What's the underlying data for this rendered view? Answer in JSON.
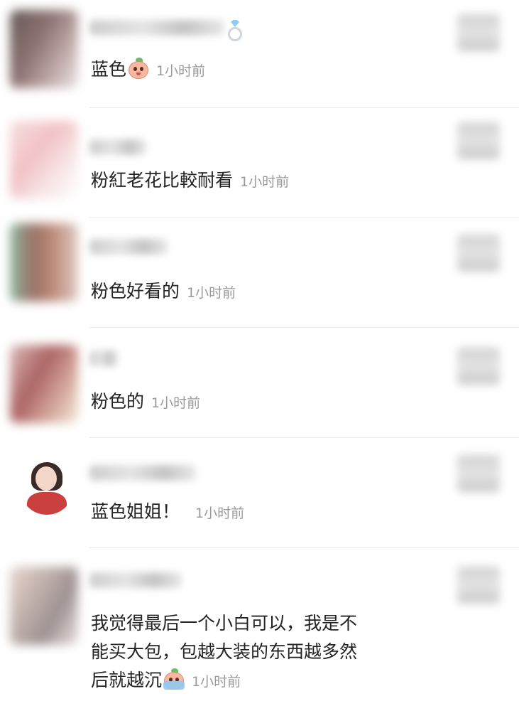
{
  "comments": [
    {
      "text": "蓝色",
      "time": "1小时前",
      "emoji": "peach-shy-emoji"
    },
    {
      "text": "粉紅老花比較耐看",
      "time": "1小时前"
    },
    {
      "text": "粉色好看的",
      "time": "1小时前"
    },
    {
      "text": "粉色的",
      "time": "1小时前"
    },
    {
      "text": "蓝色姐姐！",
      "time": "1小时前"
    },
    {
      "text_lines": [
        "我觉得最后一个小白可以，我是不",
        "能买大包，包越大装的东西越多然",
        "后就越沉"
      ],
      "time": "1小时前",
      "emoji": "peach-crying-emoji"
    }
  ],
  "icons": {
    "badge": "diamond-ring-icon"
  },
  "colors": {
    "time": "#9a9a9a",
    "text": "#232323",
    "divider": "#ececec"
  }
}
